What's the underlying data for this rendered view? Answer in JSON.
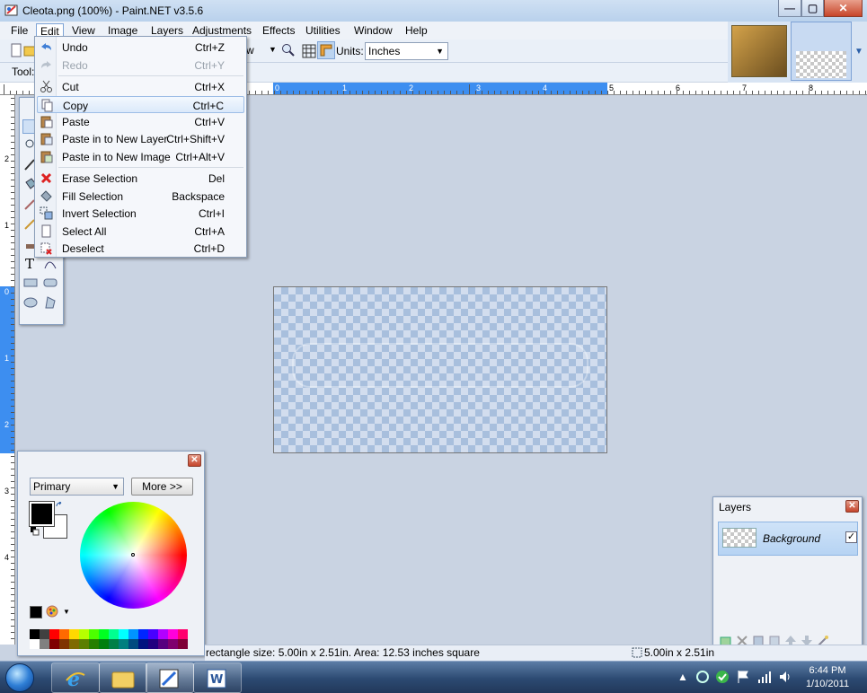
{
  "window": {
    "title": "Cleota.png (100%) - Paint.NET v3.5.6",
    "minimize": "—",
    "maximize": "▢",
    "close": "✕"
  },
  "menubar": {
    "items": [
      "File",
      "Edit",
      "View",
      "Image",
      "Layers",
      "Adjustments",
      "Effects",
      "Utilities",
      "Window",
      "Help"
    ],
    "active": "Edit"
  },
  "toolbar": {
    "zoom_partial": "w",
    "units_label": "Units:",
    "units_value": "Inches",
    "tools_label": "Tool:"
  },
  "edit_menu": {
    "items": [
      {
        "label": "Undo",
        "shortcut": "Ctrl+Z",
        "icon": "undo-icon",
        "enabled": true
      },
      {
        "label": "Redo",
        "shortcut": "Ctrl+Y",
        "icon": "redo-icon",
        "enabled": false
      },
      {
        "label": "Cut",
        "shortcut": "Ctrl+X",
        "icon": "scissors-icon",
        "enabled": true
      },
      {
        "label": "Copy",
        "shortcut": "Ctrl+C",
        "icon": "copy-icon",
        "enabled": true,
        "highlighted": true
      },
      {
        "label": "Paste",
        "shortcut": "Ctrl+V",
        "icon": "paste-icon",
        "enabled": true
      },
      {
        "label": "Paste in to New Layer",
        "shortcut": "Ctrl+Shift+V",
        "icon": "paste-layer-icon",
        "enabled": true
      },
      {
        "label": "Paste in to New Image",
        "shortcut": "Ctrl+Alt+V",
        "icon": "paste-image-icon",
        "enabled": true
      },
      {
        "label": "Erase Selection",
        "shortcut": "Del",
        "icon": "erase-icon",
        "enabled": true
      },
      {
        "label": "Fill Selection",
        "shortcut": "Backspace",
        "icon": "fill-icon",
        "enabled": true
      },
      {
        "label": "Invert Selection",
        "shortcut": "Ctrl+I",
        "icon": "invert-selection-icon",
        "enabled": true
      },
      {
        "label": "Select All",
        "shortcut": "Ctrl+A",
        "icon": "select-all-icon",
        "enabled": true
      },
      {
        "label": "Deselect",
        "shortcut": "Ctrl+D",
        "icon": "deselect-icon",
        "enabled": true
      }
    ]
  },
  "rulers": {
    "horizontal_labels": [
      "0",
      "1",
      "2",
      "3",
      "4",
      "5",
      "6",
      "7",
      "8"
    ],
    "vertical_labels": [
      "2",
      "1",
      "0",
      "1",
      "2",
      "3",
      "4"
    ]
  },
  "colors_window": {
    "mode": "Primary",
    "more_button": "More >>",
    "palette_top": [
      "#000000",
      "#404040",
      "#ff0000",
      "#ff6a00",
      "#ffd800",
      "#b6ff00",
      "#4cff00",
      "#00ff21",
      "#00ff90",
      "#00ffff",
      "#0094ff",
      "#0026ff",
      "#4800ff",
      "#b200ff",
      "#ff00dc",
      "#ff006e"
    ],
    "palette_bottom": [
      "#ffffff",
      "#808080",
      "#7f0000",
      "#7f3300",
      "#7f6a00",
      "#5b7f00",
      "#267f00",
      "#007f0e",
      "#007f46",
      "#007f7f",
      "#004a7f",
      "#00137f",
      "#21007f",
      "#57007f",
      "#7f006e",
      "#7f0037"
    ],
    "primary_color": "#000000",
    "secondary_color": "#ffffff"
  },
  "layers_window": {
    "title": "Layers",
    "layers": [
      {
        "name": "Background",
        "visible": true,
        "visible_mark": "✓"
      }
    ]
  },
  "status": {
    "selection_info": "rectangle size: 5.00in x 2.51in. Area: 12.53 inches square",
    "size_info": "5.00in x 2.51in"
  },
  "taskbar": {
    "clock_time": "6:44 PM",
    "clock_date": "1/10/2011",
    "apps": [
      "internet-explorer-icon",
      "explorer-folder-icon",
      "paintnet-icon",
      "word-icon"
    ]
  }
}
